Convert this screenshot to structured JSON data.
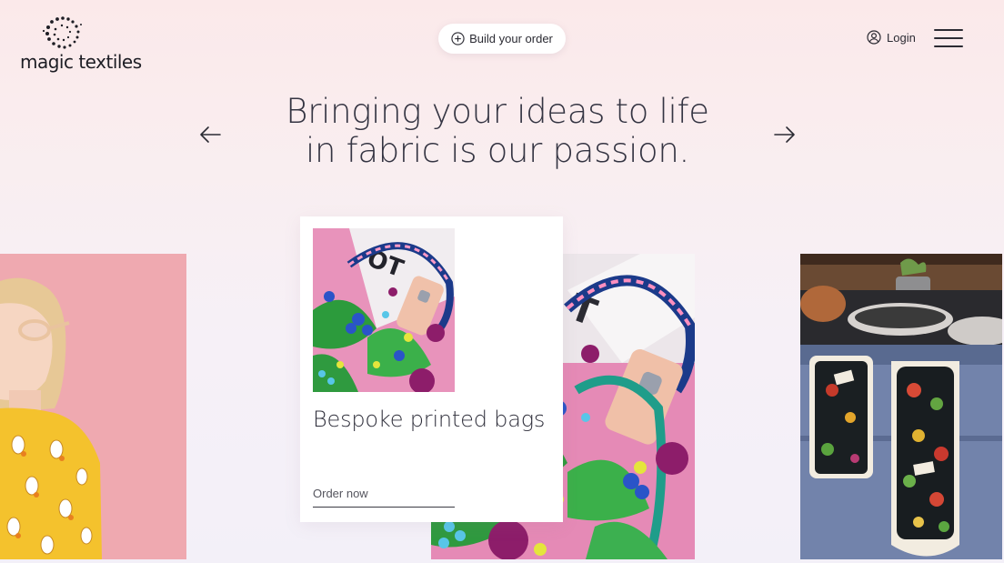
{
  "header": {
    "logo_text": "magic textiles",
    "build_order_label": "Build your order",
    "build_order_icon": "plus-circle-icon",
    "login_label": "Login",
    "login_icon": "user-circle-icon",
    "menu_icon": "hamburger-menu-icon"
  },
  "hero": {
    "headline_line1": "Bringing your ideas to life",
    "headline_line2": "in fabric is our passion.",
    "prev_icon": "arrow-left-icon",
    "next_icon": "arrow-right-icon"
  },
  "carousel": {
    "active_card": {
      "title": "Bespoke printed bags",
      "cta_label": "Order now"
    }
  },
  "colors": {
    "bg_top": "#fbe9ea",
    "bg_bottom": "#f3f0f8",
    "text": "#343442",
    "card_bg": "#ffffff",
    "pill_bg": "#ffffff"
  }
}
